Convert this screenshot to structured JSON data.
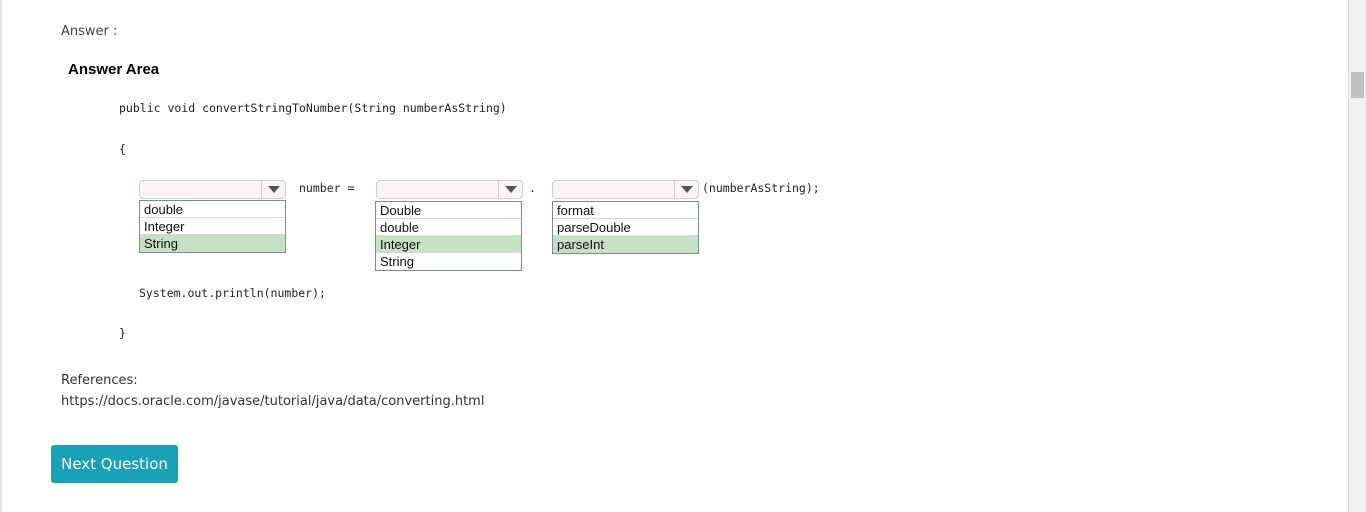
{
  "answer_label": "Answer :",
  "answer_area_title": "Answer Area",
  "code": {
    "signature": "public void convertStringToNumber(String numberAsString)",
    "open_brace": "{",
    "assign_text": "number =",
    "dot": ".",
    "call_suffix": "(numberAsString);",
    "println": "System.out.println(number);",
    "close_brace": "}"
  },
  "dropdowns": [
    {
      "name": "type-dropdown",
      "selected_value": "",
      "options": [
        {
          "label": "double",
          "selected": false
        },
        {
          "label": "Integer",
          "selected": false
        },
        {
          "label": "String",
          "selected": true
        }
      ]
    },
    {
      "name": "class-dropdown",
      "selected_value": "",
      "options": [
        {
          "label": "Double",
          "selected": false
        },
        {
          "label": "double",
          "selected": false
        },
        {
          "label": "Integer",
          "selected": true
        },
        {
          "label": "String",
          "selected": false
        }
      ]
    },
    {
      "name": "method-dropdown",
      "selected_value": "",
      "options": [
        {
          "label": "format",
          "selected": false
        },
        {
          "label": "parseDouble",
          "selected": false
        },
        {
          "label": "parseInt",
          "selected": true
        }
      ]
    }
  ],
  "references": {
    "label": "References:",
    "url": "https://docs.oracle.com/javase/tutorial/java/data/converting.html"
  },
  "next_button_label": "Next Question",
  "colors": {
    "button_bg": "#17a2b8",
    "selected_option_bg": "#c6e0c4",
    "combo_bg": "#fbf3f5"
  }
}
